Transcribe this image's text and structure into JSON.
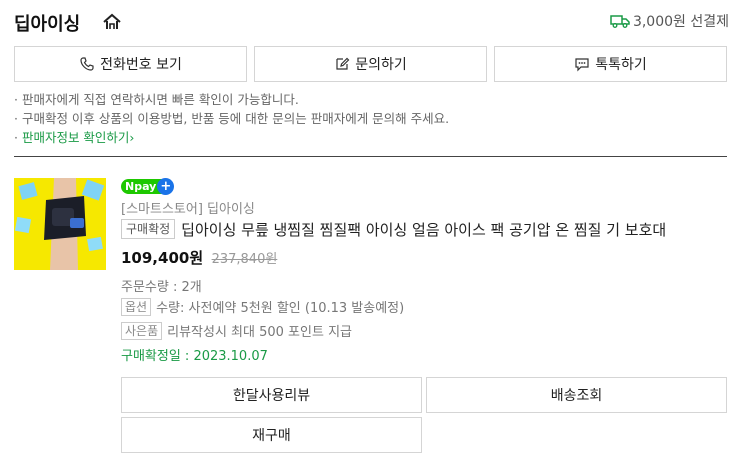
{
  "header": {
    "store_name": "딥아이싱",
    "shipping": "3,000원 선결제"
  },
  "buttons": {
    "call": "전화번호 보기",
    "inquiry": "문의하기",
    "talk": "톡톡하기"
  },
  "notes": {
    "line1": "· 판매자에게 직접 연락하시면 빠른 확인이 가능합니다.",
    "line2": "· 구매확정 이후 상품의 이용방법, 반품 등에 대한 문의는 판매자에게 문의해 주세요.",
    "line3_bullet": "· ",
    "line3_link": "판매자정보 확인하기›"
  },
  "order": {
    "npay_label": "pay",
    "store_tag": "[스마트스토어] 딥아이싱",
    "status_badge": "구매확정",
    "title": "딥아이싱 무릎 냉찜질 찜질팩 아이싱 얼음 아이스 팩 공기압 온 찜질 기 보호대",
    "price": "109,400원",
    "original_price": "237,840원",
    "quantity": "주문수량 : 2개",
    "option_tag": "옵션",
    "option_text": "수량: 사전예약 5천원 할인 (10.13 발송예정)",
    "gift_tag": "사은품",
    "gift_text": "리뷰작성시 최대 500 포인트 지급",
    "confirm_date": "구매확정일 : 2023.10.07"
  },
  "actions": {
    "review": "한달사용리뷰",
    "tracking": "배송조회",
    "reorder": "재구매"
  },
  "colors": {
    "accent_green": "#1a9a46",
    "npay_green": "#1ec800",
    "thumb_yellow": "#f6e800"
  }
}
